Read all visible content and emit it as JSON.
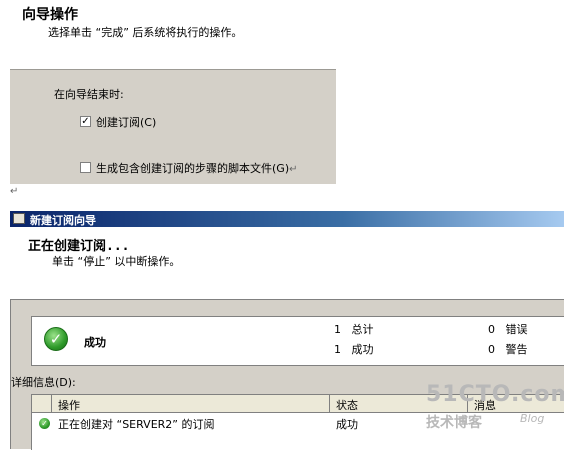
{
  "top_wizard": {
    "title": "向导操作",
    "subtitle": "选择单击 “完成” 后系统将执行的操作。",
    "panel": {
      "label": "在向导结束时:",
      "options": [
        {
          "label": "创建订阅(C)",
          "checked": true
        },
        {
          "label": "生成包含创建订阅的步骤的脚本文件(G)",
          "checked": false
        }
      ]
    }
  },
  "pilcrow": "↵",
  "window": {
    "title": "新建订阅向导",
    "header_title": "正在创建订阅...",
    "header_subtitle": "单击 “停止” 以中断操作。",
    "status": {
      "label": "成功",
      "total_count": "1",
      "total_label": "总计",
      "success_count": "1",
      "success_label": "成功",
      "error_count": "0",
      "error_label": "错误",
      "warning_count": "0",
      "warning_label": "警告"
    },
    "details_label": "详细信息(D):",
    "columns": [
      "操作",
      "状态",
      "消息"
    ],
    "rows": [
      {
        "action": "正在创建对 “SERVER2” 的订阅",
        "status": "成功",
        "message": ""
      }
    ]
  },
  "watermark": {
    "site": "51CTO.com",
    "brand": "技术博客",
    "blog": "Blog"
  },
  "colors": {
    "panel_gray": "#d4d0c8",
    "titlebar_start": "#0a246a",
    "titlebar_end": "#a6caf0",
    "success_green": "#2e9a2a"
  }
}
